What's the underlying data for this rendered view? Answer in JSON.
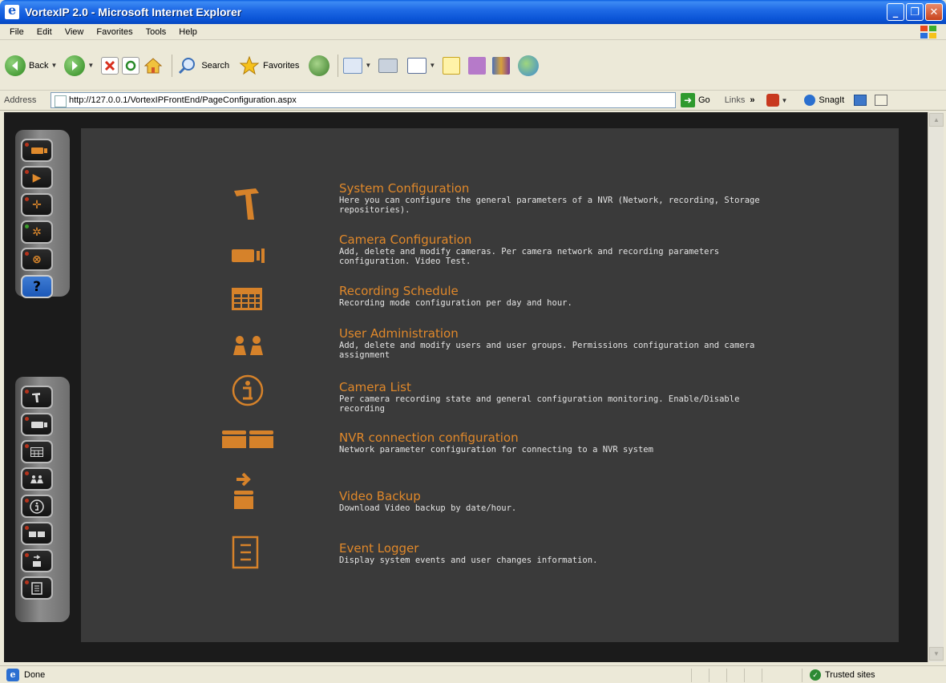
{
  "window": {
    "title": "VortexIP 2.0 - Microsoft Internet Explorer",
    "minimize": "_",
    "maximize": "❐",
    "close": "✕"
  },
  "menu": [
    "File",
    "Edit",
    "View",
    "Favorites",
    "Tools",
    "Help"
  ],
  "toolbar": {
    "back_label": "Back",
    "search_label": "Search",
    "favorites_label": "Favorites"
  },
  "address": {
    "label": "Address",
    "url": "http://127.0.0.1/VortexIPFrontEnd/PageConfiguration.aspx",
    "go_label": "Go",
    "links_label": "Links",
    "links_chevron": "»",
    "snagit_label": "SnagIt"
  },
  "dock_help_label": "?",
  "config_items": [
    {
      "title": "System Configuration",
      "desc": "Here you can configure the general parameters of a NVR (Network, recording, Storage repositories).",
      "icon": "hammer-icon"
    },
    {
      "title": "Camera Configuration",
      "desc": "Add, delete and modify cameras. Per camera network and recording parameters configuration. Video Test.",
      "icon": "camera-icon"
    },
    {
      "title": "Recording Schedule",
      "desc": "Recording mode configuration per day and hour.",
      "icon": "schedule-grid-icon"
    },
    {
      "title": "User Administration",
      "desc": "Add, delete and modify users and user groups. Permissions configuration and camera assignment",
      "icon": "users-icon"
    },
    {
      "title": "Camera List",
      "desc": "Per camera recording state and general configuration monitoring. Enable/Disable recording",
      "icon": "info-icon"
    },
    {
      "title": "NVR connection configuration",
      "desc": "Network parameter configuration for connecting to a NVR system",
      "icon": "nvr-drives-icon"
    },
    {
      "title": "Video Backup",
      "desc": "Download Video backup by date/hour.",
      "icon": "backup-icon"
    },
    {
      "title": "Event Logger",
      "desc": "Display system events and user changes information.",
      "icon": "log-document-icon"
    }
  ],
  "status": {
    "text": "Done",
    "zone": "Trusted sites"
  },
  "colors": {
    "accent_orange": "#e0882a",
    "panel_bg": "#3a3a3a",
    "page_bg": "#1b1b1b"
  }
}
